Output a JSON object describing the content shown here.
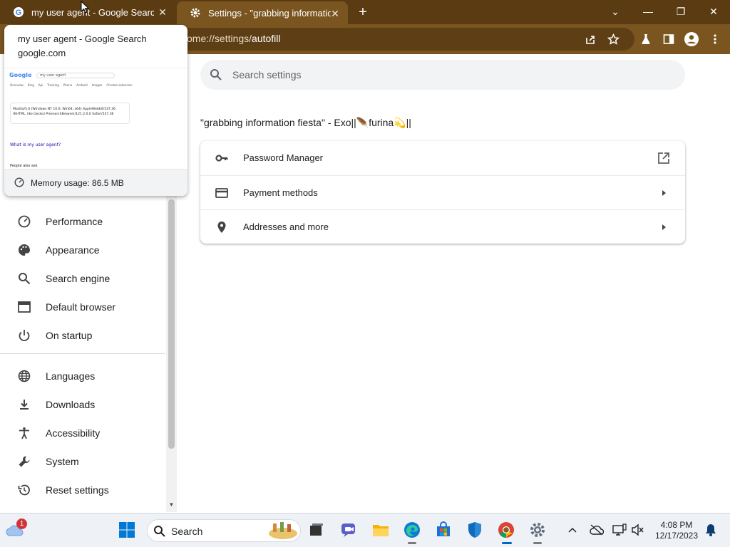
{
  "tabs": [
    {
      "title": "my user agent - Google Search",
      "close_glyph": "✕"
    },
    {
      "title": "Settings - \"grabbing information fiesta\" - Exo",
      "close_glyph": "✕"
    }
  ],
  "new_tab_glyph": "+",
  "window_controls": {
    "dropdown": "⌄",
    "minimize": "—",
    "restore": "❐",
    "close": "✕"
  },
  "omnibox": {
    "url_prefix": "ome://settings/",
    "url_path": "autofill"
  },
  "hovercard": {
    "title": "my user agent - Google Search",
    "domain": "google.com",
    "memory": "Memory usage: 86.5 MB",
    "thumb": {
      "logo": "Google",
      "query": "my user agent",
      "tabs": [
        "Overview",
        "Bing",
        "Api",
        "Tracking",
        "Phone",
        "Android",
        "Images",
        "Chrome extension"
      ],
      "ua_line1": "Mozilla/5.0 (Windows NT 10.0; Win64; x64) AppleWebKit/537.36",
      "ua_line2": "(KHTML, like Gecko) PresearchBrowser/121.2.0.0 Safari/537.36",
      "heading": "What is my user agent?",
      "paa": "People also ask"
    }
  },
  "sidebar": {
    "items": [
      {
        "label": "Performance",
        "icon": "performance-gauge-icon"
      },
      {
        "label": "Appearance",
        "icon": "palette-icon"
      },
      {
        "label": "Search engine",
        "icon": "search-icon"
      },
      {
        "label": "Default browser",
        "icon": "browser-window-icon"
      },
      {
        "label": "On startup",
        "icon": "power-icon"
      },
      {
        "label": "Languages",
        "icon": "globe-icon"
      },
      {
        "label": "Downloads",
        "icon": "download-icon"
      },
      {
        "label": "Accessibility",
        "icon": "accessibility-icon"
      },
      {
        "label": "System",
        "icon": "wrench-icon"
      },
      {
        "label": "Reset settings",
        "icon": "history-icon"
      }
    ]
  },
  "main": {
    "search_placeholder": "Search settings",
    "profile_title": "\"grabbing information fiesta\" - Exo||🪶furina💫||",
    "rows": [
      {
        "label": "Password Manager",
        "icon": "key-icon",
        "end": "external-link-icon"
      },
      {
        "label": "Payment methods",
        "icon": "credit-card-icon",
        "end": "arrow-right-icon"
      },
      {
        "label": "Addresses and more",
        "icon": "location-pin-icon",
        "end": "arrow-right-icon"
      }
    ]
  },
  "taskbar": {
    "search_label": "Search",
    "notification_count": "1",
    "time": "4:08 PM",
    "date": "12/17/2023"
  },
  "colors": {
    "titlebar": "#5b3b12",
    "toolbar": "#7a5520",
    "accent": "#1a73e8",
    "taskbar": "#eef1f6"
  }
}
